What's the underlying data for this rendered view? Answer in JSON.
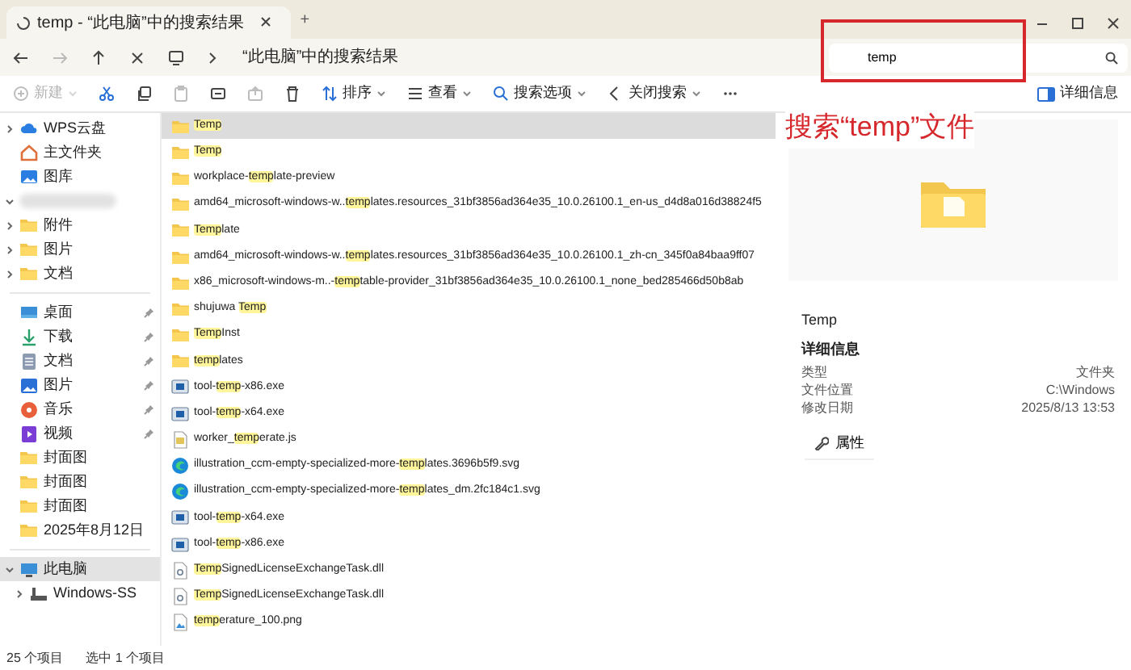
{
  "window": {
    "tabs": [
      {
        "title": "temp - “此电脑”中的搜索结果",
        "selected": true
      }
    ],
    "new_tab": "+"
  },
  "address": {
    "path": "“此电脑”中的搜索结果"
  },
  "search": {
    "value": "temp"
  },
  "toolbar": [
    {
      "kind": "new",
      "label": "新建",
      "disabled": true
    },
    {
      "kind": "cut",
      "disabled": false
    },
    {
      "kind": "copy",
      "disabled": false
    },
    {
      "kind": "paste",
      "disabled": true
    },
    {
      "kind": "rename",
      "disabled": false
    },
    {
      "kind": "share",
      "disabled": true
    },
    {
      "kind": "delete",
      "disabled": false
    },
    {
      "kind": "sort",
      "label": "排序",
      "disabled": false
    },
    {
      "kind": "view",
      "label": "查看",
      "disabled": false
    },
    {
      "kind": "search-options",
      "label": "搜索选项",
      "disabled": false
    },
    {
      "kind": "close-search",
      "label": "关闭搜索",
      "disabled": false
    },
    {
      "kind": "more",
      "disabled": false
    }
  ],
  "details_toggle": "详细信息",
  "sidebar": {
    "items": [
      {
        "kind": "cloud",
        "label": "WPS云盘",
        "expanded": false,
        "selected": false
      },
      {
        "kind": "home",
        "label": "主文件夹",
        "selected": false
      },
      {
        "kind": "gallery",
        "label": "图库",
        "selected": false
      },
      {
        "kind": "blurred",
        "expanded": true
      },
      {
        "kind": "folder",
        "label": "附件",
        "expanded": false,
        "selected": false
      },
      {
        "kind": "folder",
        "label": "图片",
        "expanded": false,
        "selected": false
      },
      {
        "kind": "folder",
        "label": "文档",
        "expanded": false,
        "selected": false
      },
      {
        "kind": "separator"
      },
      {
        "kind": "desktop",
        "label": "桌面",
        "pinned": true,
        "selected": false
      },
      {
        "kind": "download",
        "label": "下载",
        "pinned": true,
        "selected": false
      },
      {
        "kind": "document",
        "label": "文档",
        "pinned": true,
        "selected": false
      },
      {
        "kind": "pictures",
        "label": "图片",
        "pinned": true,
        "selected": false
      },
      {
        "kind": "music",
        "label": "音乐",
        "pinned": true,
        "selected": false
      },
      {
        "kind": "video",
        "label": "视频",
        "pinned": true,
        "selected": false
      },
      {
        "kind": "folder",
        "label": "封面图",
        "selected": false
      },
      {
        "kind": "folder",
        "label": "封面图",
        "selected": false
      },
      {
        "kind": "folder",
        "label": "封面图",
        "selected": false
      },
      {
        "kind": "folder",
        "label": "2025年8月12日",
        "selected": false
      },
      {
        "kind": "separator"
      },
      {
        "kind": "pc",
        "label": "此电脑",
        "expanded": true,
        "selected": true,
        "children": [
          {
            "kind": "drive",
            "label": "Windows-SS",
            "expanded": false,
            "selected": false
          }
        ]
      }
    ]
  },
  "files": [
    {
      "kind": "folder",
      "selected": true,
      "parts": [
        {
          "text": "Temp",
          "match": true
        }
      ]
    },
    {
      "kind": "folder",
      "selected": false,
      "parts": [
        {
          "text": "Temp",
          "match": true
        }
      ]
    },
    {
      "kind": "folder",
      "selected": false,
      "parts": [
        {
          "text": "workplace-",
          "match": false
        },
        {
          "text": "temp",
          "match": true
        },
        {
          "text": "late-preview",
          "match": false
        }
      ]
    },
    {
      "kind": "folder",
      "selected": false,
      "parts": [
        {
          "text": "amd64_microsoft-windows-w..",
          "match": false
        },
        {
          "text": "temp",
          "match": true
        },
        {
          "text": "lates.resources_31bf3856ad364e35_10.0.26100.1_en-us_d4d8a016d38824f5",
          "match": false
        }
      ]
    },
    {
      "kind": "folder",
      "selected": false,
      "parts": [
        {
          "text": "Temp",
          "match": true
        },
        {
          "text": "late",
          "match": false
        }
      ]
    },
    {
      "kind": "folder",
      "selected": false,
      "parts": [
        {
          "text": "amd64_microsoft-windows-w..",
          "match": false
        },
        {
          "text": "temp",
          "match": true
        },
        {
          "text": "lates.resources_31bf3856ad364e35_10.0.26100.1_zh-cn_345f0a84baa9ff07",
          "match": false
        }
      ]
    },
    {
      "kind": "folder",
      "selected": false,
      "parts": [
        {
          "text": "x86_microsoft-windows-m..-",
          "match": false
        },
        {
          "text": "temp",
          "match": true
        },
        {
          "text": "table-provider_31bf3856ad364e35_10.0.26100.1_none_bed285466d50b8ab",
          "match": false
        }
      ]
    },
    {
      "kind": "folder",
      "selected": false,
      "parts": [
        {
          "text": "shujuwa ",
          "match": false
        },
        {
          "text": "Temp",
          "match": true
        }
      ]
    },
    {
      "kind": "folder",
      "selected": false,
      "parts": [
        {
          "text": "Temp",
          "match": true
        },
        {
          "text": "Inst",
          "match": false
        }
      ]
    },
    {
      "kind": "folder",
      "selected": false,
      "parts": [
        {
          "text": "temp",
          "match": true
        },
        {
          "text": "lates",
          "match": false
        }
      ]
    },
    {
      "kind": "exe",
      "selected": false,
      "parts": [
        {
          "text": "tool-",
          "match": false
        },
        {
          "text": "temp",
          "match": true
        },
        {
          "text": "-x86.exe",
          "match": false
        }
      ]
    },
    {
      "kind": "exe",
      "selected": false,
      "parts": [
        {
          "text": "tool-",
          "match": false
        },
        {
          "text": "temp",
          "match": true
        },
        {
          "text": "-x64.exe",
          "match": false
        }
      ]
    },
    {
      "kind": "js",
      "selected": false,
      "parts": [
        {
          "text": "worker_",
          "match": false
        },
        {
          "text": "temp",
          "match": true
        },
        {
          "text": "erate.js",
          "match": false
        }
      ]
    },
    {
      "kind": "svg",
      "selected": false,
      "parts": [
        {
          "text": "illustration_ccm-empty-specialized-more-",
          "match": false
        },
        {
          "text": "temp",
          "match": true
        },
        {
          "text": "lates.3696b5f9.svg",
          "match": false
        }
      ]
    },
    {
      "kind": "svg",
      "selected": false,
      "parts": [
        {
          "text": "illustration_ccm-empty-specialized-more-",
          "match": false
        },
        {
          "text": "temp",
          "match": true
        },
        {
          "text": "lates_dm.2fc184c1.svg",
          "match": false
        }
      ]
    },
    {
      "kind": "exe",
      "selected": false,
      "parts": [
        {
          "text": "tool-",
          "match": false
        },
        {
          "text": "temp",
          "match": true
        },
        {
          "text": "-x64.exe",
          "match": false
        }
      ]
    },
    {
      "kind": "exe",
      "selected": false,
      "parts": [
        {
          "text": "tool-",
          "match": false
        },
        {
          "text": "temp",
          "match": true
        },
        {
          "text": "-x86.exe",
          "match": false
        }
      ]
    },
    {
      "kind": "dll",
      "selected": false,
      "parts": [
        {
          "text": "Temp",
          "match": true
        },
        {
          "text": "SignedLicenseExchangeTask.dll",
          "match": false
        }
      ]
    },
    {
      "kind": "dll",
      "selected": false,
      "parts": [
        {
          "text": "Temp",
          "match": true
        },
        {
          "text": "SignedLicenseExchangeTask.dll",
          "match": false
        }
      ]
    },
    {
      "kind": "png",
      "selected": false,
      "parts": [
        {
          "text": "temp",
          "match": true
        },
        {
          "text": "erature_100.png",
          "match": false
        }
      ]
    }
  ],
  "details": {
    "name": "Temp",
    "heading": "详细信息",
    "rows": [
      {
        "label": "类型",
        "value": "文件夹"
      },
      {
        "label": "文件位置",
        "value": "C:\\Windows"
      },
      {
        "label": "修改日期",
        "value": "2025/8/13 13:53"
      }
    ],
    "button": "属性"
  },
  "annotation": {
    "text": "搜索“temp”文件"
  },
  "status_bar": {
    "count": "25 个项目",
    "selection": "选中 1 个项目"
  }
}
